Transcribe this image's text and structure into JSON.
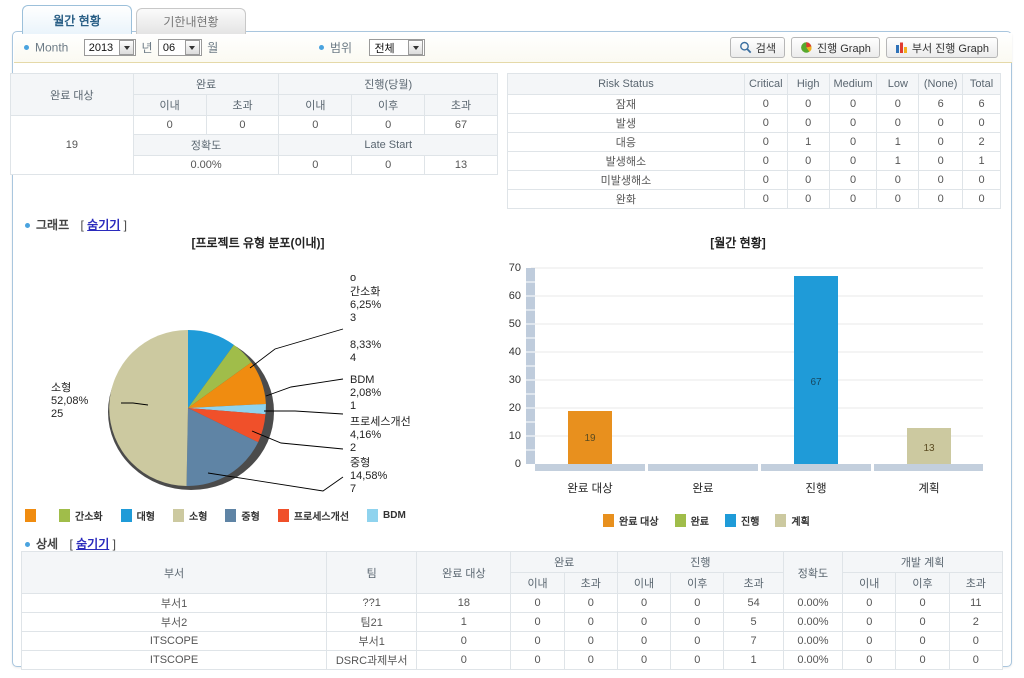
{
  "tabs": [
    {
      "label": "월간 현황",
      "active": true
    },
    {
      "label": "기한내현황",
      "active": false
    }
  ],
  "filters": {
    "month_label": "Month",
    "year_value": "2013",
    "year_suffix": "년",
    "month_value": "06",
    "month_suffix": "월",
    "scope_label": "범위",
    "scope_value": "전체"
  },
  "toolbar": {
    "search_label": "검색",
    "progress_graph_label": "진행 Graph",
    "dept_progress_graph_label": "부서 진행 Graph"
  },
  "summary": {
    "target_header": "완료 대상",
    "target_value": "19",
    "done_header": "완료",
    "progress_header": "진행(당월)",
    "sub_within": "이내",
    "sub_over": "초과",
    "sub_after": "이후",
    "row1": [
      "0",
      "0",
      "0",
      "0",
      "67"
    ],
    "accuracy_header": "정확도",
    "accuracy_value": "0.00%",
    "late_start_header": "Late Start",
    "late_row": [
      "0",
      "0",
      "13"
    ]
  },
  "risk": {
    "title": "Risk Status",
    "columns": [
      "Critical",
      "High",
      "Medium",
      "Low",
      "(None)",
      "Total"
    ],
    "rows": [
      {
        "label": "잠재",
        "values": [
          "0",
          "0",
          "0",
          "0",
          "6",
          "6"
        ]
      },
      {
        "label": "발생",
        "values": [
          "0",
          "0",
          "0",
          "0",
          "0",
          "0"
        ]
      },
      {
        "label": "대응",
        "values": [
          "0",
          "1",
          "0",
          "1",
          "0",
          "2"
        ]
      },
      {
        "label": "발생해소",
        "values": [
          "0",
          "0",
          "0",
          "1",
          "0",
          "1"
        ]
      },
      {
        "label": "미발생해소",
        "values": [
          "0",
          "0",
          "0",
          "0",
          "0",
          "0"
        ]
      },
      {
        "label": "완화",
        "values": [
          "0",
          "0",
          "0",
          "0",
          "0",
          "0"
        ]
      }
    ]
  },
  "graph_section": {
    "title": "그래프",
    "toggle": "숨기기",
    "open_bracket": "[",
    "close_bracket": "]"
  },
  "detail_section": {
    "title": "상세",
    "toggle": "숨기기",
    "open_bracket": "[",
    "close_bracket": "]"
  },
  "chart_data": [
    {
      "type": "pie",
      "title": "[프로젝트 유형 분포(이내)]",
      "categories": [
        "대형",
        "간소화",
        "o",
        "BDM",
        "프로세스개선",
        "중형",
        "소형"
      ],
      "slices": [
        {
          "name": "대형",
          "percent": 12.5,
          "count": 6,
          "color": "#1f9bd8",
          "label_shown": false
        },
        {
          "name": "간소화",
          "percent": 6.25,
          "count": 3,
          "color": "#a0bd4a",
          "label_shown": true
        },
        {
          "name": "o",
          "percent": 8.33,
          "count": 4,
          "color": "#f08c10",
          "label_shown": true
        },
        {
          "name": "BDM",
          "percent": 2.08,
          "count": 1,
          "color": "#8fd3ee",
          "label_shown": true
        },
        {
          "name": "프로세스개선",
          "percent": 4.16,
          "count": 2,
          "color": "#f0502a",
          "label_shown": true
        },
        {
          "name": "중형",
          "percent": 14.58,
          "count": 7,
          "color": "#5f84a5",
          "label_shown": true
        },
        {
          "name": "소형",
          "percent": 52.08,
          "count": 25,
          "color": "#ccc9a0",
          "label_shown": true
        }
      ],
      "callouts": [
        {
          "name": "o",
          "pct": "",
          "count": ""
        },
        {
          "name": "간소화",
          "pct": "6,25%",
          "count": "3"
        },
        {
          "name": "",
          "pct": "8,33%",
          "count": "4"
        },
        {
          "name": "BDM",
          "pct": "2,08%",
          "count": "1"
        },
        {
          "name": "프로세스개선",
          "pct": "4,16%",
          "count": "2"
        },
        {
          "name": "중형",
          "pct": "14,58%",
          "count": "7"
        },
        {
          "name": "소형",
          "pct": "52,08%",
          "count": "25"
        }
      ],
      "legend": [
        {
          "label": "",
          "color": "#f08c10"
        },
        {
          "label": "간소화",
          "color": "#a0bd4a"
        },
        {
          "label": "대형",
          "color": "#1f9bd8"
        },
        {
          "label": "소형",
          "color": "#ccc9a0"
        },
        {
          "label": "중형",
          "color": "#5f84a5"
        },
        {
          "label": "프로세스개선",
          "color": "#f0502a"
        },
        {
          "label": "BDM",
          "color": "#8fd3ee"
        }
      ],
      "legend_position": "bottom"
    },
    {
      "type": "bar",
      "title": "[월간 현황]",
      "categories": [
        "완료 대상",
        "완료",
        "진행",
        "계획"
      ],
      "values": [
        19,
        0,
        67,
        13
      ],
      "colors": [
        "#e8901e",
        "#a0bd4a",
        "#1f9bd8",
        "#ccc9a0"
      ],
      "ylim": [
        0,
        70
      ],
      "yticks": [
        "0",
        "10",
        "20",
        "30",
        "40",
        "50",
        "60",
        "70"
      ],
      "xlabel": "",
      "ylabel": "",
      "grid": true,
      "legend": [
        {
          "label": "완료 대상",
          "color": "#e8901e"
        },
        {
          "label": "완료",
          "color": "#a0bd4a"
        },
        {
          "label": "진행",
          "color": "#1f9bd8"
        },
        {
          "label": "계획",
          "color": "#ccc9a0"
        }
      ],
      "legend_position": "bottom"
    }
  ],
  "detail": {
    "headers": {
      "dept": "부서",
      "team": "팀",
      "target": "완료 대상",
      "done": "완료",
      "progress": "진행",
      "accuracy": "정확도",
      "plan": "개발 계획",
      "within": "이내",
      "over": "초과",
      "after": "이후"
    },
    "rows": [
      {
        "dept": "부서1",
        "team": "??1",
        "target": "18",
        "done_within": "0",
        "done_over": "0",
        "prog_within": "0",
        "prog_after": "0",
        "prog_over": "54",
        "accuracy": "0.00%",
        "plan_within": "0",
        "plan_after": "0",
        "plan_over": "11"
      },
      {
        "dept": "부서2",
        "team": "팀21",
        "target": "1",
        "done_within": "0",
        "done_over": "0",
        "prog_within": "0",
        "prog_after": "0",
        "prog_over": "5",
        "accuracy": "0.00%",
        "plan_within": "0",
        "plan_after": "0",
        "plan_over": "2"
      },
      {
        "dept": "ITSCOPE",
        "team": "부서1",
        "target": "0",
        "done_within": "0",
        "done_over": "0",
        "prog_within": "0",
        "prog_after": "0",
        "prog_over": "7",
        "accuracy": "0.00%",
        "plan_within": "0",
        "plan_after": "0",
        "plan_over": "0"
      },
      {
        "dept": "ITSCOPE",
        "team": "DSRC과제부서",
        "target": "0",
        "done_within": "0",
        "done_over": "0",
        "prog_within": "0",
        "prog_after": "0",
        "prog_over": "1",
        "accuracy": "0.00%",
        "plan_within": "0",
        "plan_after": "0",
        "plan_over": "0"
      }
    ]
  }
}
